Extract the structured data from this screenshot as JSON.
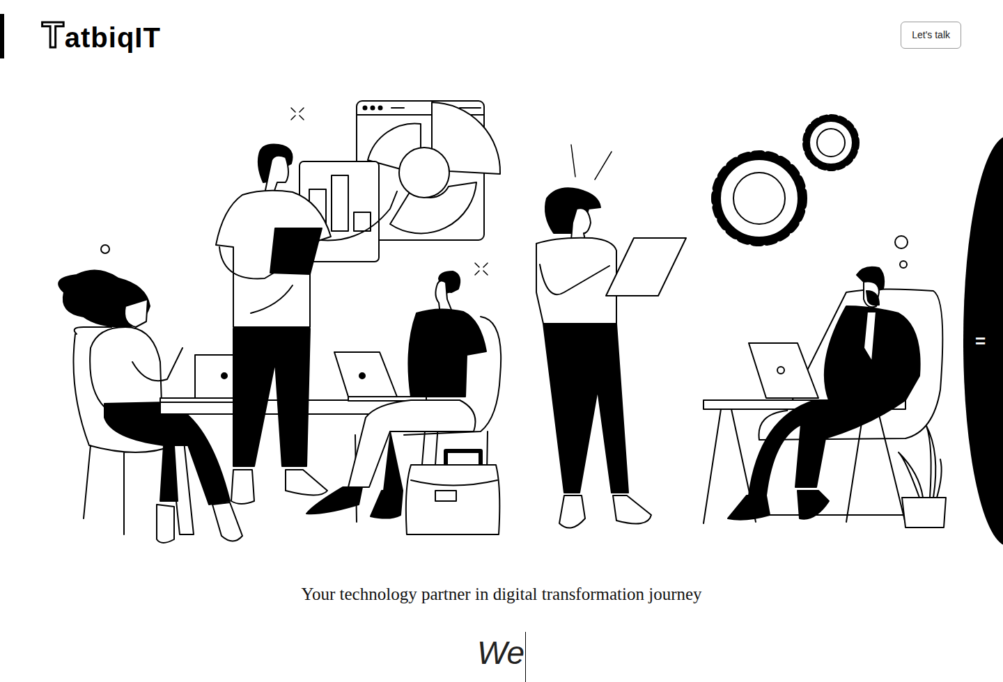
{
  "logo": {
    "mark": "T",
    "text": "atbiqIT"
  },
  "header": {
    "cta": "Let's talk"
  },
  "hero": {
    "tagline": "Your technology partner in digital transformation journey",
    "typed": "We"
  },
  "menu": {
    "icon": "="
  }
}
